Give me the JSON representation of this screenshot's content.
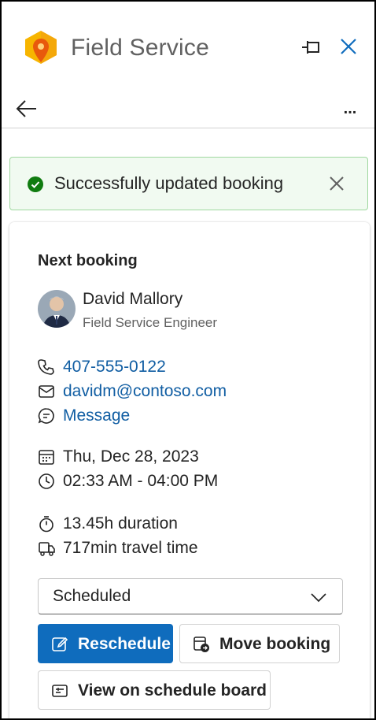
{
  "header": {
    "app_title": "Field Service",
    "brand_color": "#f7a800"
  },
  "toolbar": {
    "more_label": "..."
  },
  "toast": {
    "message": "Successfully updated booking",
    "status_color": "#107c10"
  },
  "booking": {
    "title": "Next booking",
    "person": {
      "name": "David Mallory",
      "role": "Field Service Engineer"
    },
    "contact": {
      "phone": "407-555-0122",
      "email": "davidm@contoso.com",
      "message": "Message"
    },
    "date": "Thu, Dec 28, 2023",
    "time": "02:33 AM - 04:00 PM",
    "duration": "13.45h duration",
    "travel": "717min travel time",
    "status": {
      "selected": "Scheduled"
    },
    "actions": {
      "reschedule": "Reschedule",
      "move": "Move booking",
      "view_board": "View on schedule board"
    }
  },
  "icons": [
    "app-logo-icon",
    "pin-icon",
    "close-icon",
    "back-arrow-icon",
    "more-icon",
    "success-check-icon",
    "dismiss-icon",
    "phone-icon",
    "mail-icon",
    "chat-icon",
    "calendar-icon",
    "clock-icon",
    "timer-icon",
    "vehicle-icon",
    "chevron-down-icon",
    "edit-icon",
    "calendar-move-icon",
    "schedule-board-icon"
  ],
  "colors": {
    "accent": "#0f6cbd",
    "link": "#115ea3"
  }
}
